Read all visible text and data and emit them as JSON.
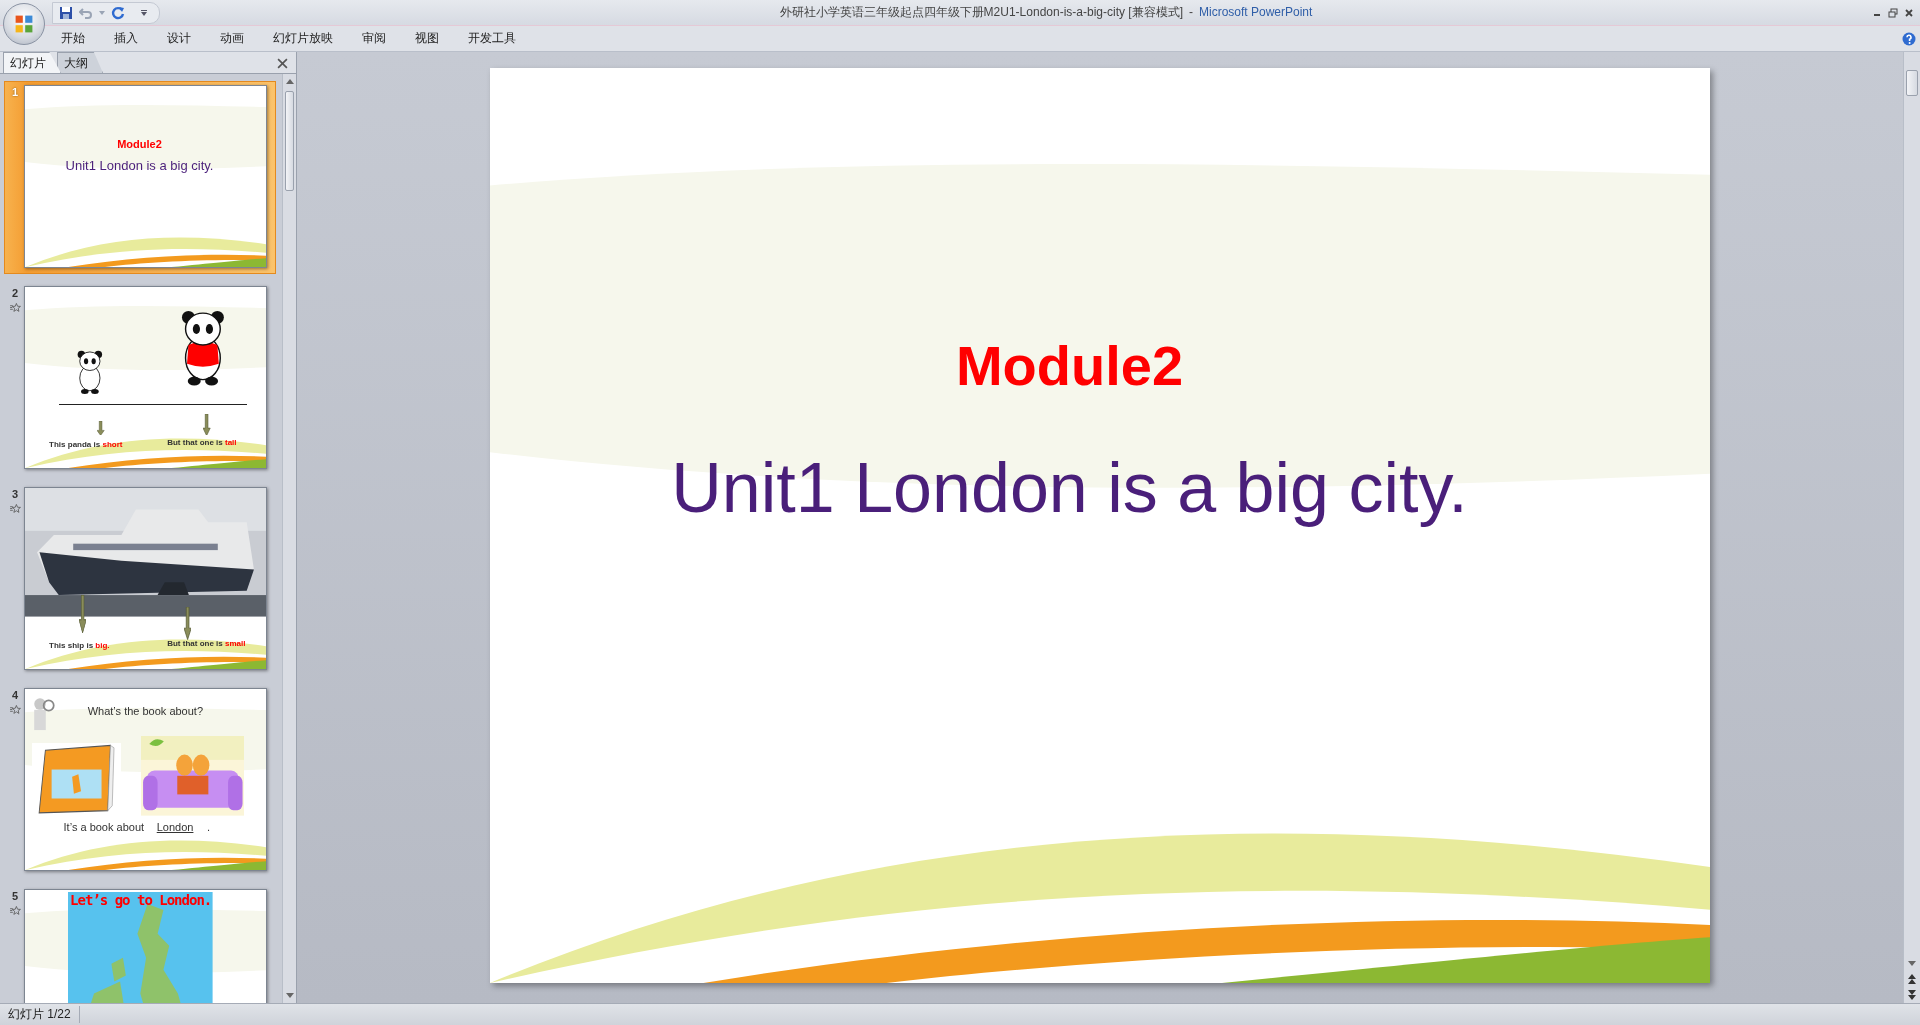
{
  "window": {
    "document_title": "外研社小学英语三年级起点四年级下册M2U1-London-is-a-big-city [兼容模式]",
    "separator": "-",
    "app_name": "Microsoft PowerPoint"
  },
  "ribbon_tabs": [
    "开始",
    "插入",
    "设计",
    "动画",
    "幻灯片放映",
    "审阅",
    "视图",
    "开发工具"
  ],
  "panel_tabs": [
    {
      "label": "幻灯片",
      "selected": true
    },
    {
      "label": "大纲",
      "selected": false
    }
  ],
  "slides": [
    {
      "number": "1",
      "selected": true,
      "animated": false,
      "kind": "title",
      "title": "Module2",
      "subtitle": "Unit1 London is a big city."
    },
    {
      "number": "2",
      "selected": false,
      "animated": true,
      "kind": "pandas",
      "captions": [
        "This panda is **short**",
        "But that one is **tall**"
      ]
    },
    {
      "number": "3",
      "selected": false,
      "animated": true,
      "kind": "ship",
      "captions": [
        "This ship is **big.**",
        "But that one is **small**"
      ]
    },
    {
      "number": "4",
      "selected": false,
      "animated": true,
      "kind": "question",
      "question": "What’s the book about?",
      "answer_prefix": "It’s a book about",
      "answer": "London",
      "answer_suffix": "."
    },
    {
      "number": "5",
      "selected": false,
      "animated": true,
      "kind": "map",
      "title": "Let’s go to London."
    }
  ],
  "main_slide": {
    "title": "Module2",
    "subtitle": "Unit1 London is a big city."
  },
  "status_bar": {
    "slide_counter": "幻灯片 1/22"
  }
}
